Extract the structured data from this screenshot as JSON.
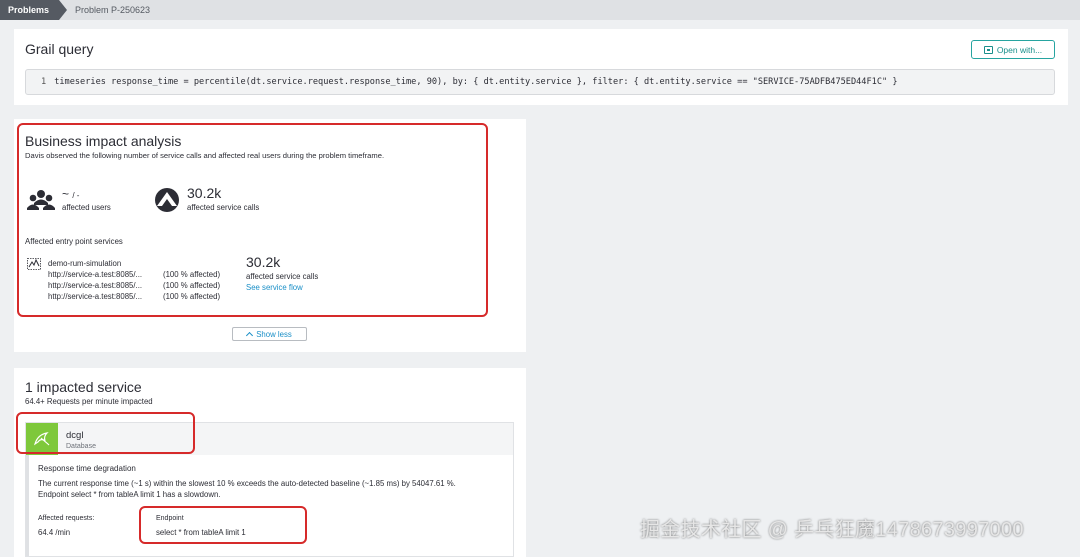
{
  "breadcrumb": {
    "items": [
      "Problems",
      "Problem P-250623"
    ]
  },
  "grail": {
    "title": "Grail query",
    "open_button": "Open with...",
    "line_number": "1",
    "query": "timeseries response_time = percentile(dt.service.request.response_time, 90), by: { dt.entity.service }, filter: { dt.entity.service == \"SERVICE-75ADFB475ED44F1C\" }"
  },
  "business": {
    "title": "Business impact analysis",
    "subtitle": "Davis observed the following number of service calls and affected real users during the problem timeframe.",
    "users_value": "~",
    "users_value_suffix": "/ -",
    "users_label": "affected users",
    "calls_value": "30.2k",
    "calls_label": "affected service calls",
    "entry_heading": "Affected entry point services",
    "service_name": "demo-rum-simulation",
    "service_rows": [
      {
        "url": "http://service-a.test:8085/...",
        "pct": "(100 % affected)"
      },
      {
        "url": "http://service-a.test:8085/...",
        "pct": "(100 % affected)"
      },
      {
        "url": "http://service-a.test:8085/...",
        "pct": "(100 % affected)"
      }
    ],
    "entry_calls_value": "30.2k",
    "entry_calls_label": "affected service calls",
    "service_flow_link": "See service flow",
    "show_less": "Show less"
  },
  "impacted": {
    "title": "1 impacted service",
    "subtitle": "64.4+ Requests per minute impacted",
    "service_name": "dcgl",
    "service_type": "Database",
    "degradation_title": "Response time degradation",
    "degradation_line1": "The current response time (~1 s) within the slowest 10 % exceeds the auto-detected baseline (~1.85 ms) by 54047.61 %.",
    "degradation_line2": "Endpoint select * from tableA limit 1 has a slowdown.",
    "affected_requests_label": "Affected requests:",
    "affected_requests_value": "64.4 /min",
    "endpoint_label": "Endpoint",
    "endpoint_value": "select * from tableA limit 1"
  },
  "watermark": "掘金技术社区 @ 乒乓狂魔1478673997000",
  "colors": {
    "accent": "#26a4a0",
    "link": "#1a8fc7",
    "db_green": "#7ec83b",
    "annotation_red": "#d62a2a"
  }
}
